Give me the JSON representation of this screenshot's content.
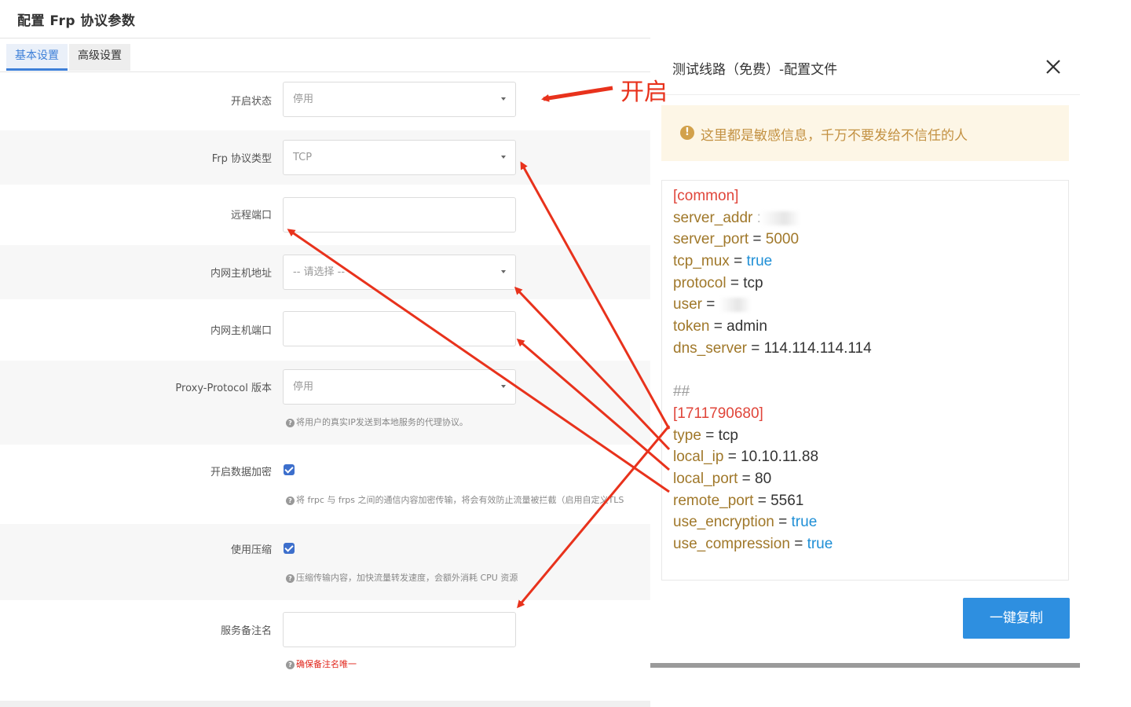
{
  "page": {
    "title": "配置 Frp 协议参数",
    "tabs": [
      {
        "label": "基本设置",
        "active": true
      },
      {
        "label": "高级设置",
        "active": false
      }
    ]
  },
  "form": {
    "enable_status": {
      "label": "开启状态",
      "value": "停用"
    },
    "frp_type": {
      "label": "Frp 协议类型",
      "value": "TCP"
    },
    "remote_port": {
      "label": "远程端口",
      "value": ""
    },
    "local_host": {
      "label": "内网主机地址",
      "placeholder": "-- 请选择 --"
    },
    "local_port": {
      "label": "内网主机端口",
      "value": ""
    },
    "proxy_protocol": {
      "label": "Proxy-Protocol 版本",
      "value": "停用",
      "hint": "将用户的真实IP发送到本地服务的代理协议。"
    },
    "encryption": {
      "label": "开启数据加密",
      "checked": true,
      "hint": "将 frpc 与 frps 之间的通信内容加密传输，将会有效防止流量被拦截（启用自定义TLS"
    },
    "compression": {
      "label": "使用压缩",
      "checked": true,
      "hint": "压缩传输内容，加快流量转发速度，会额外消耗 CPU 资源"
    },
    "remark": {
      "label": "服务备注名",
      "value": "",
      "hint": "确保备注名唯一"
    }
  },
  "annotation": {
    "text": "开启",
    "color": "#e8321c"
  },
  "modal": {
    "title": "测试线路（免费）-配置文件",
    "close_icon": "close-icon",
    "warning": "这里都是敏感信息，千万不要发给不信任的人",
    "copy_button": "一键复制",
    "config": {
      "common_header": "[common]",
      "server_addr_key": "server_addr",
      "server_port_key": "server_port",
      "server_port_val": "5000",
      "tcp_mux_key": "tcp_mux",
      "tcp_mux_val": "true",
      "protocol_key": "protocol",
      "protocol_val": "tcp",
      "user_key": "user",
      "token_key": "token",
      "token_val": "admin",
      "dns_key": "dns_server",
      "dns_val": "114.114.114.114",
      "comment": "##",
      "section_header": "[1711790680]",
      "type_key": "type",
      "type_val": "tcp",
      "local_ip_key": "local_ip",
      "local_ip_val": "10.10.11.88",
      "local_port_key": "local_port",
      "local_port_val": "80",
      "remote_port_key": "remote_port",
      "remote_port_val": "5561",
      "use_enc_key": "use_encryption",
      "use_enc_val": "true",
      "use_comp_key": "use_compression",
      "use_comp_val": "true"
    }
  },
  "colors": {
    "accent": "#3d7fd8",
    "copy_button": "#2e8fe0",
    "warning_bg": "#fdf6e6",
    "config_key": "#a0782a",
    "config_section": "#e0453a",
    "config_bool": "#1f8fd6",
    "annotation": "#e8321c"
  }
}
